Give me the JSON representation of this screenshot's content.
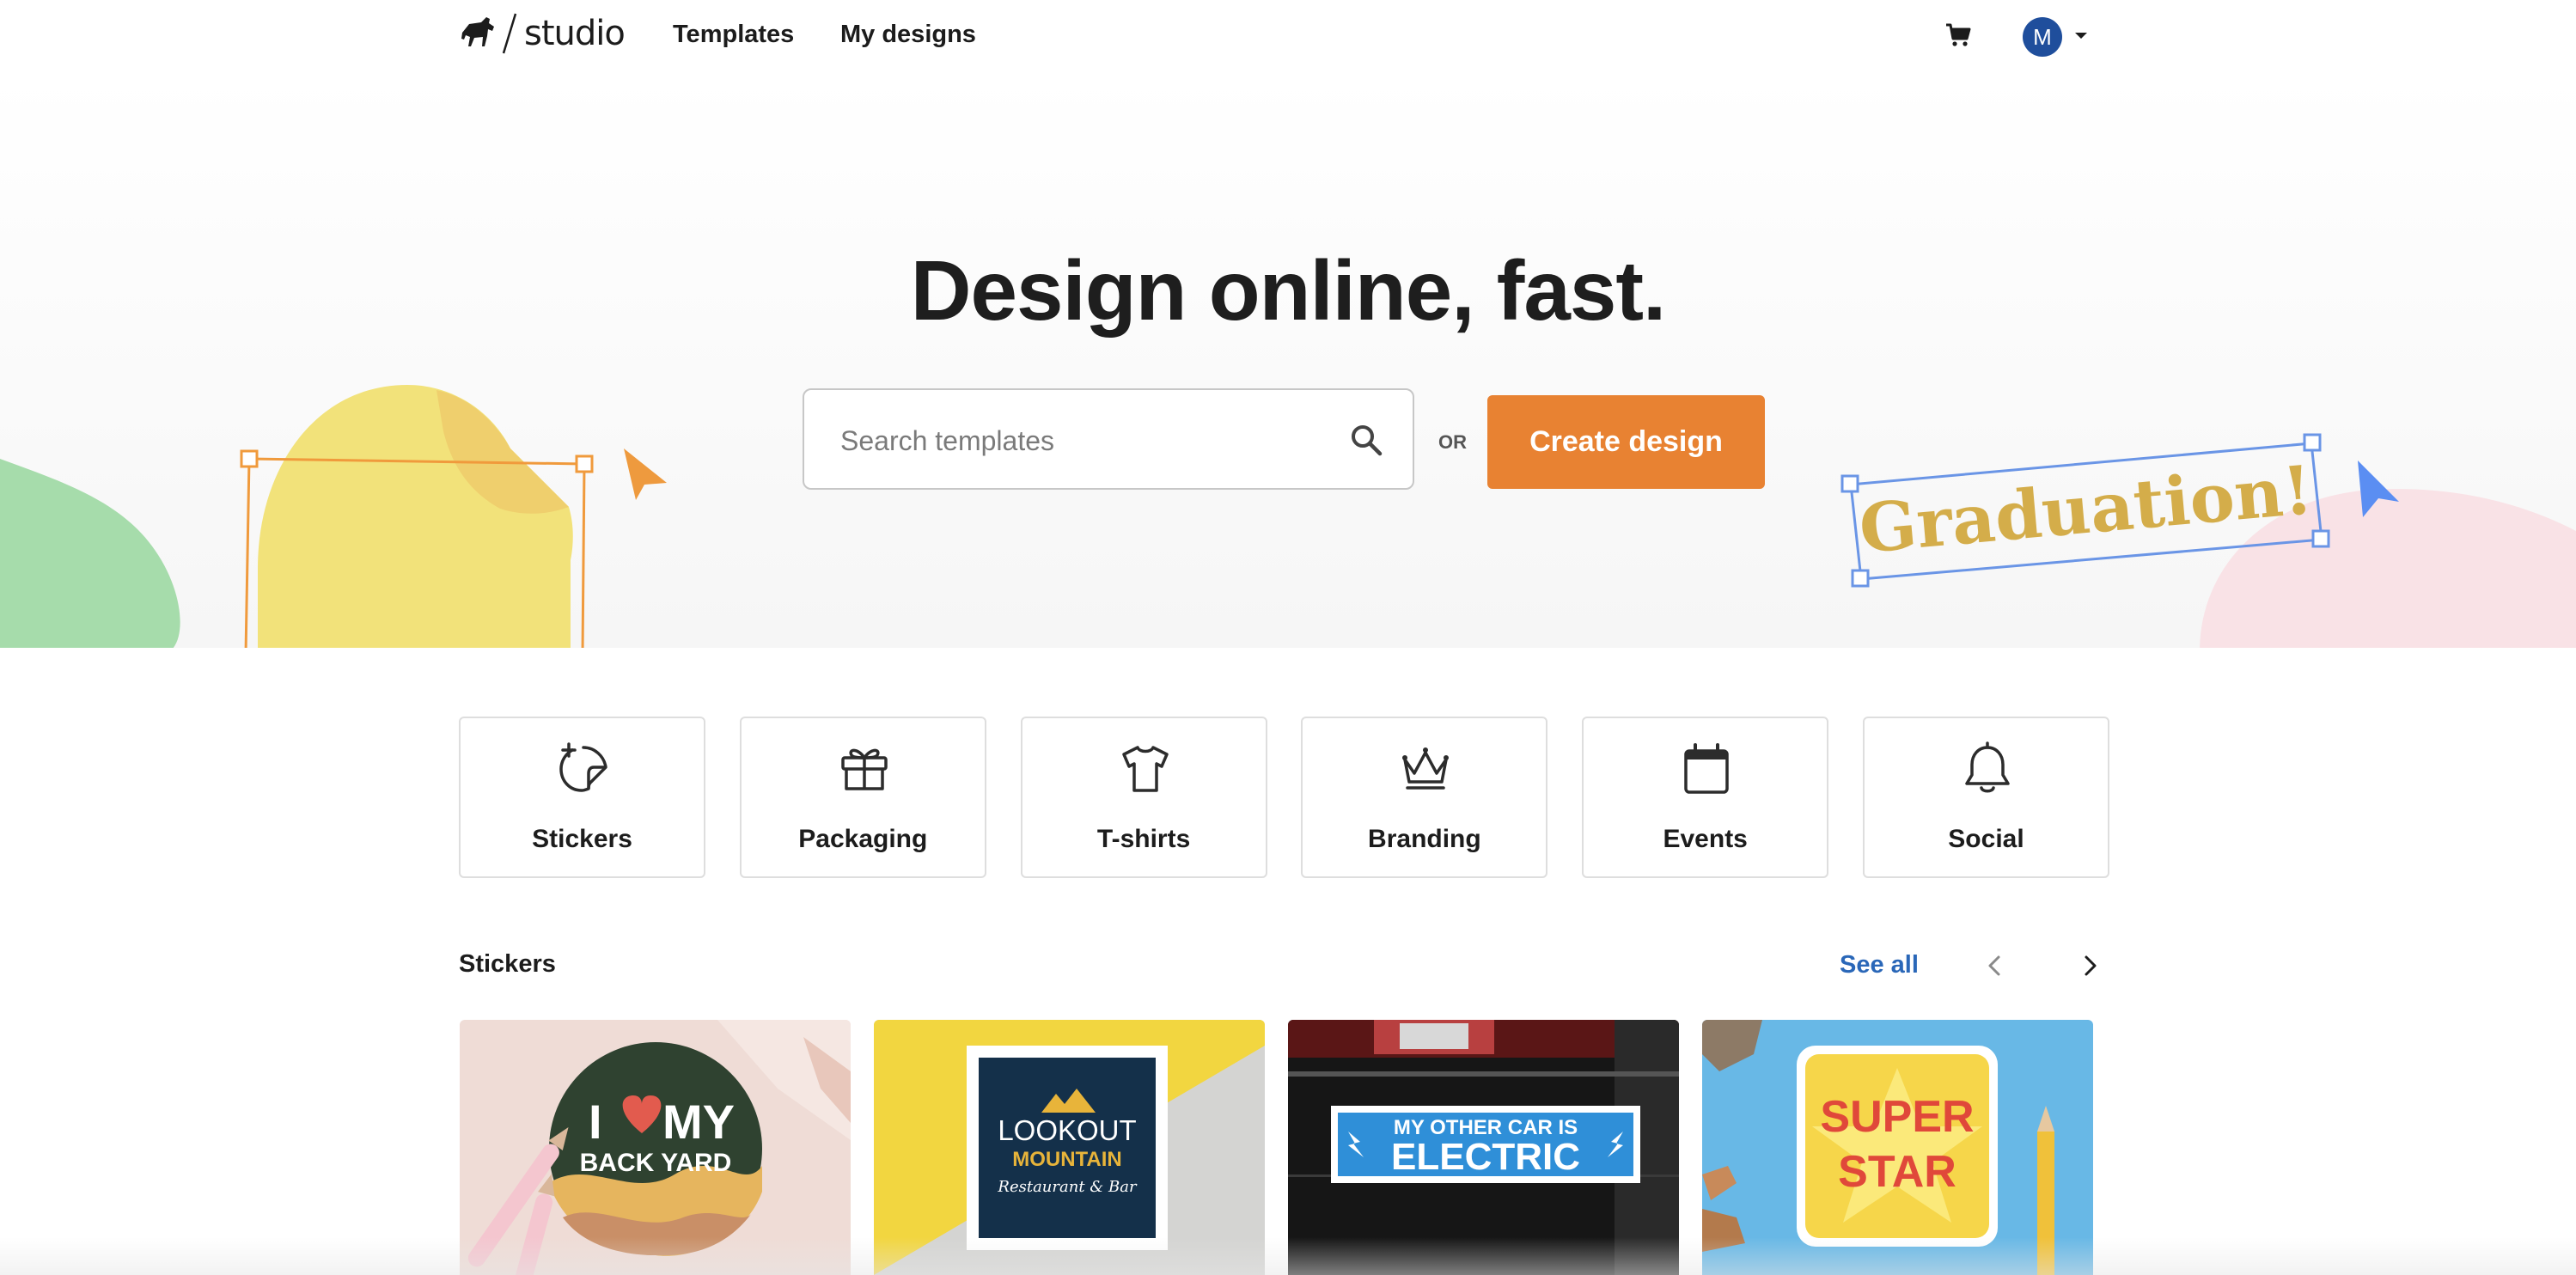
{
  "header": {
    "logo_text": "studio",
    "nav": [
      {
        "label": "Templates"
      },
      {
        "label": "My designs"
      }
    ],
    "avatar_initial": "M"
  },
  "hero": {
    "title": "Design online, fast.",
    "search_placeholder": "Search templates",
    "or_label": "OR",
    "create_button": "Create design",
    "decor_text": "Graduation!"
  },
  "categories": [
    {
      "label": "Stickers",
      "icon": "sticker-icon"
    },
    {
      "label": "Packaging",
      "icon": "gift-box-icon"
    },
    {
      "label": "T-shirts",
      "icon": "tshirt-icon"
    },
    {
      "label": "Branding",
      "icon": "crown-icon"
    },
    {
      "label": "Events",
      "icon": "calendar-icon"
    },
    {
      "label": "Social",
      "icon": "bell-icon"
    }
  ],
  "stickers_section": {
    "title": "Stickers",
    "see_all": "See all",
    "cards": [
      {
        "line1_a": "I",
        "line1_b": "MY",
        "line2": "BACK YARD",
        "icon": "heart-icon"
      },
      {
        "line1": "LOOKOUT",
        "line2": "MOUNTAIN",
        "line3": "Restaurant & Bar"
      },
      {
        "line1": "MY OTHER CAR IS",
        "line2": "ELECTRIC"
      },
      {
        "line1": "SUPER",
        "line2": "STAR"
      }
    ]
  },
  "colors": {
    "accent": "#e88232",
    "link": "#2a67b8",
    "avatar": "#1f4e9c"
  }
}
